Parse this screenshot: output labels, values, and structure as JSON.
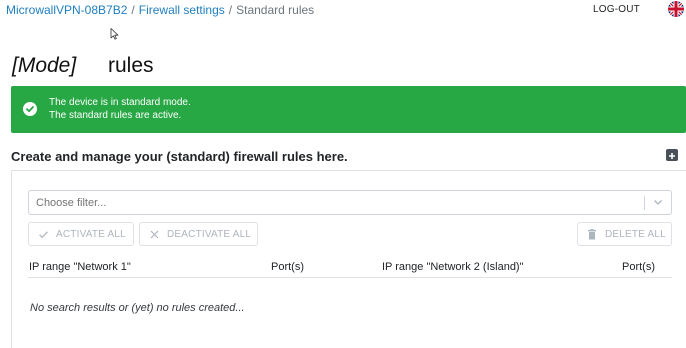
{
  "breadcrumb": {
    "device": "MicrowallVPN-08B7B2",
    "firewall_settings": "Firewall settings",
    "current": "Standard rules",
    "separator": "/"
  },
  "header": {
    "logout_label": "LOG-OUT",
    "language_icon": "uk-flag-icon"
  },
  "page": {
    "mode_label": "[Mode]",
    "title": "rules"
  },
  "alert": {
    "line1": "The device is in standard mode.",
    "line2": "The standard rules are active.",
    "color": "#28a745",
    "icon": "check-circle-icon"
  },
  "section": {
    "title": "Create and manage your (standard) firewall rules here.",
    "add_icon": "plus-square-icon"
  },
  "filter": {
    "placeholder": "Choose filter...",
    "icon": "chevron-down-icon"
  },
  "actions": {
    "activate_all": "ACTIVATE ALL",
    "deactivate_all": "DEACTIVATE ALL",
    "delete_all": "DELETE ALL"
  },
  "table": {
    "columns": [
      "IP range \"Network 1\"",
      "Port(s)",
      "IP range \"Network 2 (Island)\"",
      "Port(s)"
    ],
    "empty_message": "No search results or (yet) no rules created..."
  },
  "colors": {
    "link": "#1f7fbf",
    "success": "#28a745",
    "disabled_text": "#adb5bd"
  }
}
